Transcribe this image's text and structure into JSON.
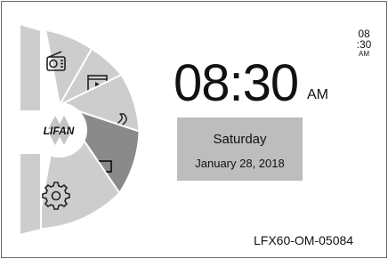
{
  "brand": {
    "logo_text": "LIFAN"
  },
  "menu": [
    {
      "id": "radio",
      "icon": "radio-icon"
    },
    {
      "id": "media",
      "icon": "play-icon"
    },
    {
      "id": "phone",
      "icon": "phone-icon"
    },
    {
      "id": "phone-mirror",
      "icon": "phone-mirror-icon",
      "selected": true
    },
    {
      "id": "settings",
      "icon": "gear-icon"
    }
  ],
  "clock": {
    "time": "08:30",
    "ampm": "AM"
  },
  "date": {
    "day": "Saturday",
    "full": "January 28, 2018"
  },
  "status_clock": {
    "hour": "08",
    "minute": ":30",
    "ampm": "AM"
  },
  "figure_ref": "LFX60-OM-05084",
  "colors": {
    "sector": "#cdcdcd",
    "sector_selected": "#8a8a8a",
    "date_card": "#bdbdbd",
    "outline": "#777777"
  }
}
